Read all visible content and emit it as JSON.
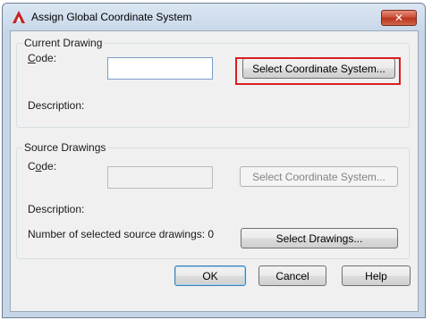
{
  "window": {
    "title": "Assign Global Coordinate System",
    "close_label": "✕"
  },
  "current_drawing": {
    "group_title": "Current Drawing",
    "code_label": "Code:",
    "code_value": "",
    "select_button": "Select Coordinate System...",
    "description_label": "Description:"
  },
  "source_drawings": {
    "group_title": "Source Drawings",
    "code_label": "Code:",
    "code_value": "",
    "select_button": "Select Coordinate System...",
    "description_label": "Description:",
    "count_text": "Number of selected source drawings: 0",
    "select_drawings_button": "Select Drawings..."
  },
  "footer": {
    "ok": "OK",
    "cancel": "Cancel",
    "help": "Help"
  },
  "colors": {
    "highlight": "#d9201f",
    "app_icon": "#c8201e"
  }
}
